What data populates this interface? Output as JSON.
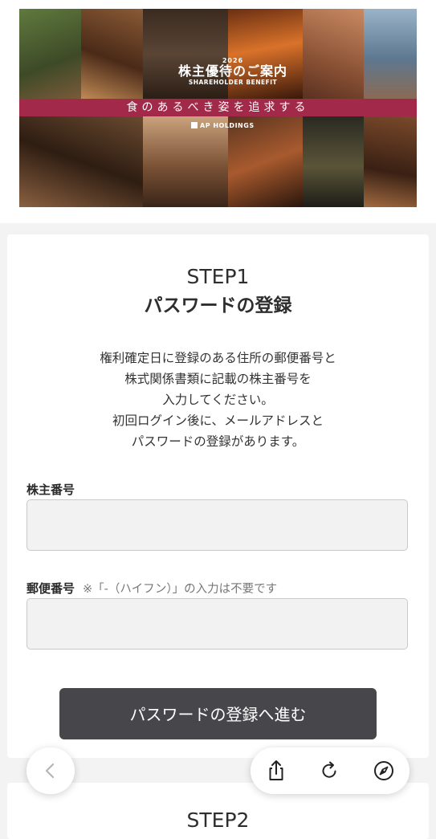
{
  "banner": {
    "year": "2026",
    "title": "株主優待のご案内",
    "subtitle": "SHAREHOLDER BENEFIT",
    "slogan": "食のあるべき姿を追求する",
    "logo_text": "AP HOLDINGS"
  },
  "step1": {
    "title": "STEP1",
    "subtitle": "パスワードの登録",
    "description": [
      "権利確定日に登録のある住所の郵便番号と",
      "株式関係書類に記載の株主番号を",
      "入力してください。",
      "初回ログイン後に、メールアドレスと",
      "パスワードの登録があります。"
    ]
  },
  "form": {
    "shareholder_label": "株主番号",
    "shareholder_value": "",
    "postal_label": "郵便番号",
    "postal_note": "※「-（ハイフン）」の入力は不要です",
    "postal_value": "",
    "submit_label": "パスワードの登録へ進む"
  },
  "step2": {
    "title": "STEP2"
  },
  "browser_toolbar": {
    "back_icon": "chevron-left-icon",
    "share_icon": "share-icon",
    "reload_icon": "reload-icon",
    "compass_icon": "compass-icon"
  },
  "colors": {
    "accent_strip": "#a3294a",
    "button_bg": "#47464a"
  }
}
